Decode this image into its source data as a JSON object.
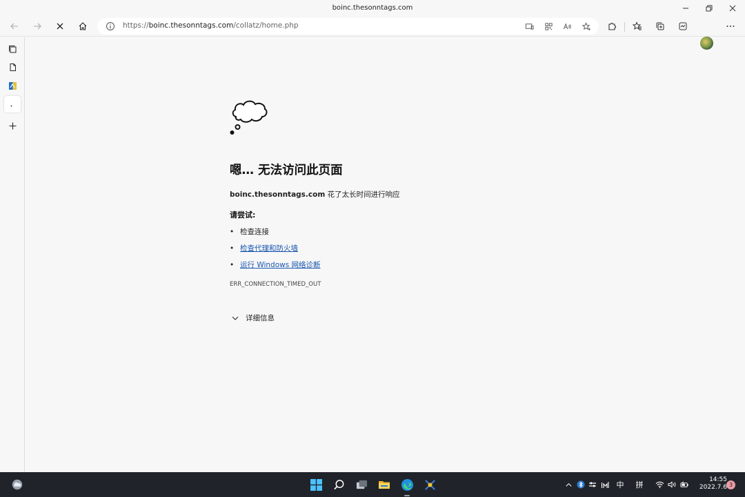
{
  "window": {
    "title": "boinc.thesonntags.com"
  },
  "toolbar": {
    "url_prefix": "https://",
    "url_host": "boinc.thesonntags.com",
    "url_path": "/collatz/home.php"
  },
  "error_page": {
    "heading": "嗯… 无法访问此页面",
    "host": "boinc.thesonntags.com",
    "message": " 花了太长时间进行响应",
    "try_label": "请尝试:",
    "suggestions": [
      {
        "bullet": "•",
        "text": "检查连接"
      },
      {
        "bullet": "•",
        "text": "检查代理和防火墙"
      },
      {
        "bullet": "•",
        "text": "运行 Windows 网络诊断"
      }
    ],
    "error_code": "ERR_CONNECTION_TIMED_OUT",
    "details_label": "详细信息"
  },
  "taskbar": {
    "ime_lang": "中",
    "ime_mode": "拼",
    "time": "14:55",
    "date": "2022.7.6",
    "notification_count": "3"
  },
  "colors": {
    "link": "#1a56b0",
    "taskbar_bg": "#20242a",
    "page_bg": "#f7f7f7"
  }
}
